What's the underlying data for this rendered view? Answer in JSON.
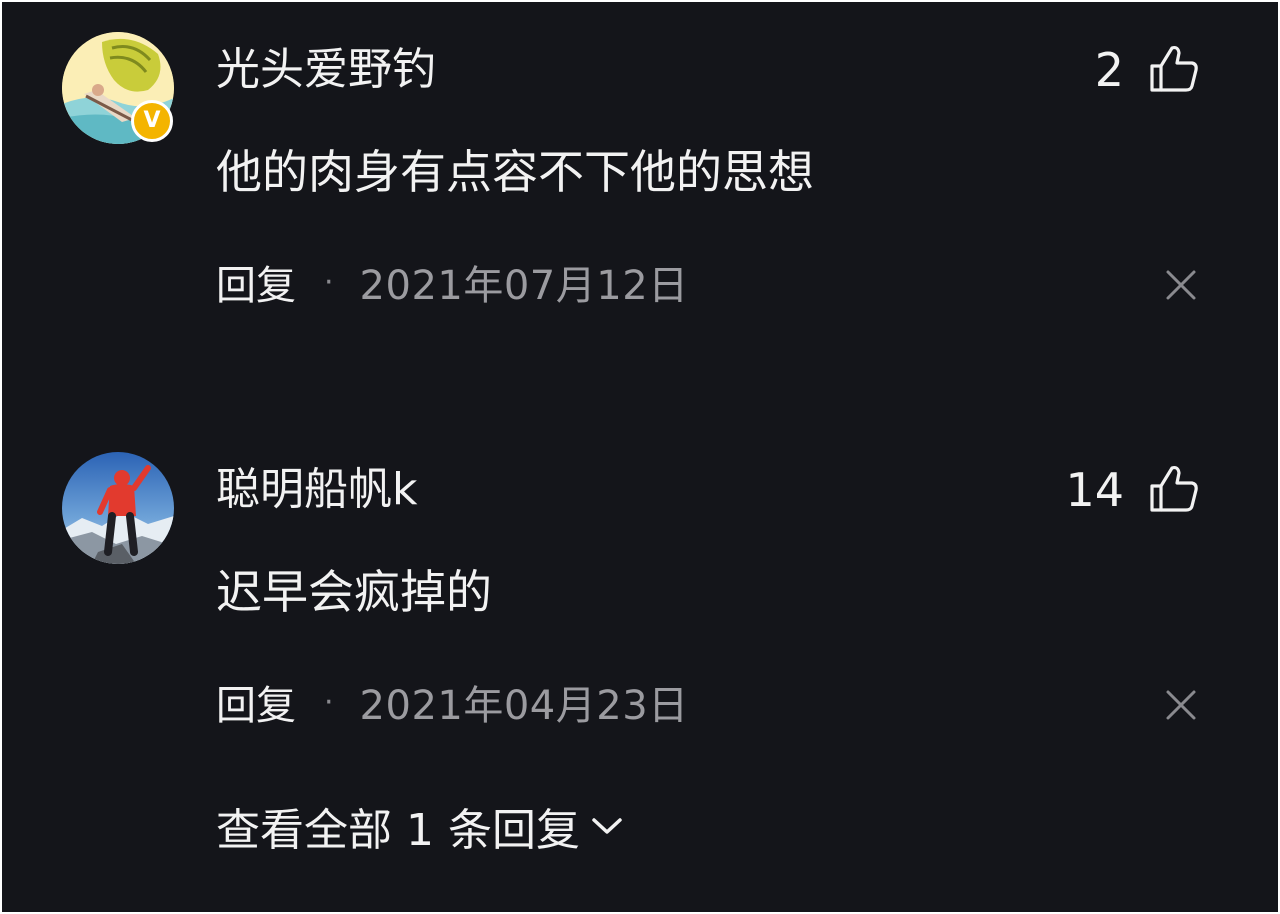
{
  "comments": [
    {
      "username": "光头爱野钓",
      "verified_badge": "V",
      "likes": "2",
      "content": "他的肉身有点容不下他的思想",
      "reply_label": "回复",
      "separator": "·",
      "date": "2021年07月12日",
      "avatar_icon": "avatar-verified-user",
      "like_icon": "thumbs-up-icon",
      "close_icon": "close-icon"
    },
    {
      "username": "聪明船帆k",
      "likes": "14",
      "content": "迟早会疯掉的",
      "reply_label": "回复",
      "separator": "·",
      "date": "2021年04月23日",
      "avatar_icon": "avatar-climber",
      "like_icon": "thumbs-up-icon",
      "close_icon": "close-icon",
      "view_replies_label": "查看全部 1 条回复"
    }
  ],
  "colors": {
    "background": "#14151a",
    "primary_text": "#f2f2f2",
    "secondary_text": "#9b9ba0",
    "badge": "#f4b400"
  }
}
